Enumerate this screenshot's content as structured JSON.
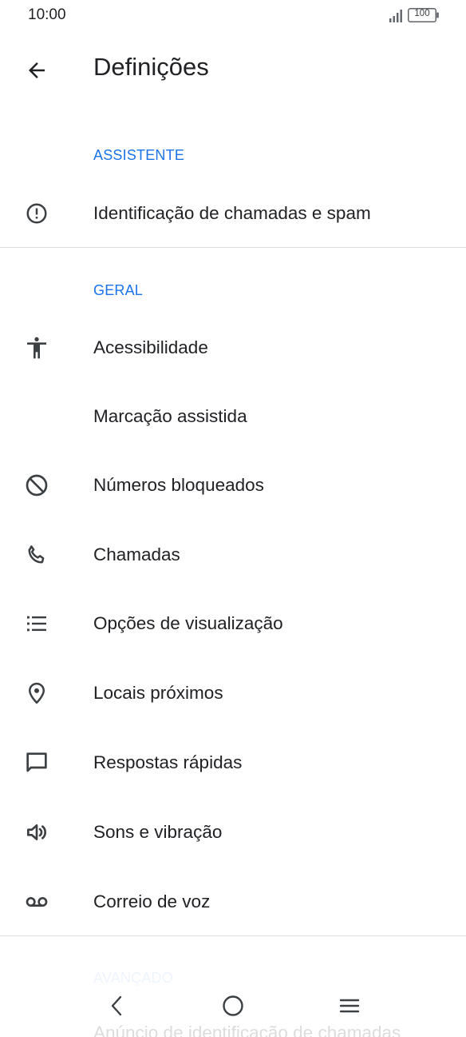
{
  "status_bar": {
    "time": "10:00",
    "battery": "100"
  },
  "app_bar": {
    "title": "Definições"
  },
  "sections": {
    "assistant": {
      "header": "ASSISTENTE",
      "items": [
        {
          "label": "Identificação de chamadas e spam",
          "icon": "alert-circle-icon"
        }
      ]
    },
    "general": {
      "header": "GERAL",
      "items": [
        {
          "label": "Acessibilidade",
          "icon": "accessibility-icon"
        },
        {
          "label": "Marcação assistida",
          "icon": ""
        },
        {
          "label": "Números bloqueados",
          "icon": "block-icon"
        },
        {
          "label": "Chamadas",
          "icon": "phone-icon"
        },
        {
          "label": "Opções de visualização",
          "icon": "list-icon"
        },
        {
          "label": "Locais próximos",
          "icon": "location-pin-icon"
        },
        {
          "label": "Respostas rápidas",
          "icon": "message-icon"
        },
        {
          "label": "Sons e vibração",
          "icon": "volume-icon"
        },
        {
          "label": "Correio de voz",
          "icon": "voicemail-icon"
        }
      ]
    },
    "advanced": {
      "header": "AVANÇADO",
      "items": [
        {
          "label": "Anúncio de identificação de chamadas"
        }
      ]
    }
  },
  "nav_bar": {
    "buttons": [
      "back-icon",
      "home-icon",
      "menu-icon"
    ]
  },
  "colors": {
    "accent": "#1a73e8",
    "text": "#202124",
    "icon": "#3c4043",
    "divider": "#dadce0"
  }
}
